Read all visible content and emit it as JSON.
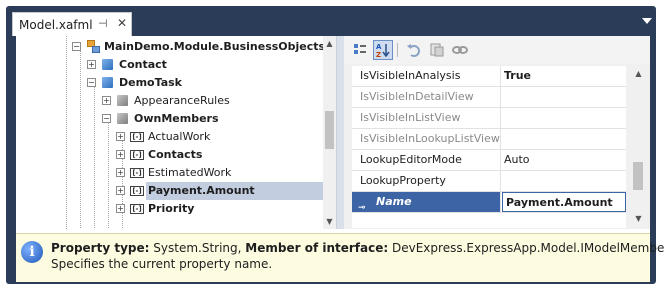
{
  "window": {
    "tab_title": "Model.xafml",
    "pin_icon": "pin-icon",
    "close_icon": "close-icon",
    "menu_icon": "dropdown-arrow-icon"
  },
  "tree": {
    "rows": [
      {
        "label": "MainDemo.Module.BusinessObjects",
        "bold": true,
        "icon": "node-icon"
      },
      {
        "label": "Contact",
        "bold": true,
        "icon": "class-cube-icon"
      },
      {
        "label": "DemoTask",
        "bold": true,
        "icon": "class-cube-icon"
      },
      {
        "label": "AppearanceRules",
        "bold": false,
        "icon": "folder-cube-icon"
      },
      {
        "label": "OwnMembers",
        "bold": true,
        "icon": "folder-cube-icon"
      },
      {
        "label": "ActualWork",
        "bold": false,
        "icon": "member-icon"
      },
      {
        "label": "Contacts",
        "bold": true,
        "icon": "member-icon"
      },
      {
        "label": "EstimatedWork",
        "bold": false,
        "icon": "member-icon"
      },
      {
        "label": "Payment.Amount",
        "bold": true,
        "icon": "member-icon",
        "selected": true
      },
      {
        "label": "Priority",
        "bold": true,
        "icon": "member-icon"
      }
    ]
  },
  "propertygrid": {
    "toolbar": [
      "categorized-icon",
      "alphabetical-icon",
      "undo-icon",
      "reset-icon",
      "link-icon"
    ],
    "rows": [
      {
        "name": "IsVisibleInAnalysis",
        "value": "True",
        "dim": false
      },
      {
        "name": "IsVisibleInDetailView",
        "value": "",
        "dim": true
      },
      {
        "name": "IsVisibleInListView",
        "value": "",
        "dim": true
      },
      {
        "name": "IsVisibleInLookupListView",
        "value": "",
        "dim": true
      },
      {
        "name": "LookupEditorMode",
        "value": "Auto",
        "dim": false
      },
      {
        "name": "LookupProperty",
        "value": "",
        "dim": false
      },
      {
        "name": "Name",
        "value": "Payment.Amount",
        "dim": false,
        "selected": true
      }
    ]
  },
  "description": {
    "property_type_label": "Property type:",
    "property_type_value": "System.String,",
    "interface_label": "Member of interface:",
    "interface_value": "DevExpress.ExpressApp.Model.IModelMember",
    "text": "Specifies the current property name."
  },
  "colors": {
    "frame": "#2b3c59",
    "selection": "#3d64a4",
    "tree_selection": "#c3cde0",
    "info_bar": "#fdfbe0"
  }
}
